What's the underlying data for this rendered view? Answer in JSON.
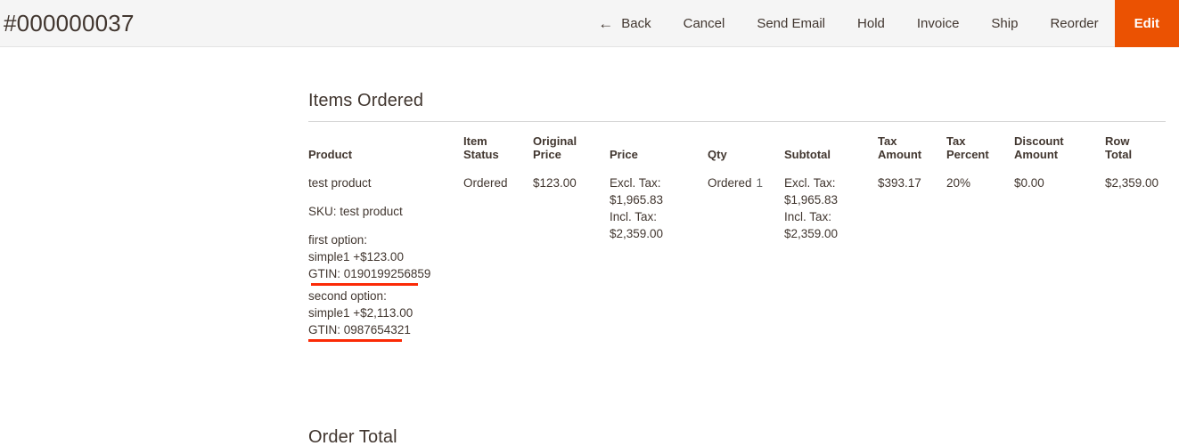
{
  "header": {
    "order_title": "#000000037",
    "actions": [
      {
        "name": "back",
        "label": "Back",
        "icon": "arrow-left-icon",
        "style": "link"
      },
      {
        "name": "cancel",
        "label": "Cancel",
        "icon": null,
        "style": "link"
      },
      {
        "name": "send-email",
        "label": "Send Email",
        "icon": null,
        "style": "link"
      },
      {
        "name": "hold",
        "label": "Hold",
        "icon": null,
        "style": "link"
      },
      {
        "name": "invoice",
        "label": "Invoice",
        "icon": null,
        "style": "link"
      },
      {
        "name": "ship",
        "label": "Ship",
        "icon": null,
        "style": "link"
      },
      {
        "name": "reorder",
        "label": "Reorder",
        "icon": null,
        "style": "link"
      },
      {
        "name": "edit",
        "label": "Edit",
        "icon": null,
        "style": "primary"
      }
    ],
    "back_icon_glyph": "←",
    "primary_color": "#eb5202",
    "background_color": "#f5f5f5"
  },
  "items_ordered": {
    "title": "Items Ordered",
    "columns": [
      {
        "line1": "Product",
        "line2": ""
      },
      {
        "line1": "Item",
        "line2": "Status"
      },
      {
        "line1": "Original",
        "line2": "Price"
      },
      {
        "line1": "Price",
        "line2": ""
      },
      {
        "line1": "Qty",
        "line2": ""
      },
      {
        "line1": "Subtotal",
        "line2": ""
      },
      {
        "line1": "Tax",
        "line2": "Amount"
      },
      {
        "line1": "Tax",
        "line2": "Percent"
      },
      {
        "line1": "Discount",
        "line2": "Amount"
      },
      {
        "line1": "Row",
        "line2": "Total"
      }
    ],
    "rows": [
      {
        "product": {
          "name": "test product",
          "sku": "SKU: test product",
          "options": [
            {
              "label": "first option:",
              "value": "simple1 +$123.00",
              "gtin": "GTIN: 0190199256859",
              "gtin_underlined": true
            },
            {
              "label": "second option:",
              "value": "simple1 +$2,113.00",
              "gtin": "GTIN: 0987654321",
              "gtin_underlined": true
            }
          ]
        },
        "item_status": "Ordered",
        "original_price": "$123.00",
        "price": {
          "excl_label": "Excl. Tax:",
          "excl_value": "$1,965.83",
          "incl_label": "Incl. Tax:",
          "incl_value": "$2,359.00"
        },
        "qty": {
          "label": "Ordered",
          "value": "1"
        },
        "subtotal": {
          "excl_label": "Excl. Tax:",
          "excl_value": "$1,965.83",
          "incl_label": "Incl. Tax:",
          "incl_value": "$2,359.00"
        },
        "tax_amount": "$393.17",
        "tax_percent": "20%",
        "discount_amount": "$0.00",
        "row_total": "$2,359.00"
      }
    ],
    "highlight_color": "#fb2a06"
  },
  "order_total": {
    "title": "Order Total"
  }
}
